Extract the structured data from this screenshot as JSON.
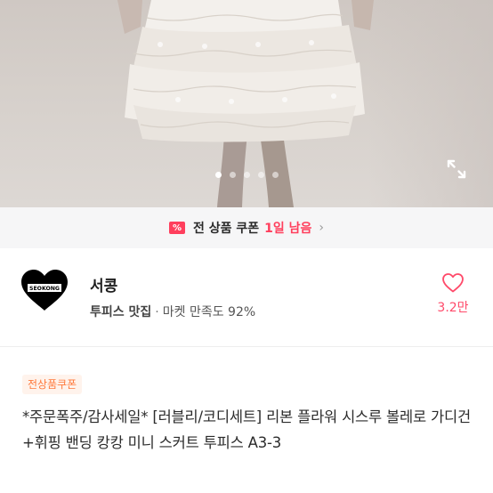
{
  "gallery": {
    "dots": [
      true,
      false,
      false,
      false,
      false
    ],
    "expand_icon": "expand-icon"
  },
  "coupon_bar": {
    "icon": "coupon-icon",
    "icon_glyph": "%",
    "text": "전 상품 쿠폰",
    "remaining": "1일 남음",
    "chevron": "›",
    "accent": "#ff3f5d"
  },
  "shop": {
    "logo_text": "SEOKONG",
    "name": "서콩",
    "category": "투피스 맛집",
    "separator": "·",
    "satisfaction": "마켓 만족도 92%",
    "favorite_icon": "heart-icon",
    "favorite_count": "3.2만",
    "favorite_color": "#ff4a6a"
  },
  "product": {
    "badge": "전상품쿠폰",
    "title": "*주문폭주/감사세일* [러블리/코디세트] 리본 플라워 시스루 볼레로 가디건+휘핑 밴딩 캉캉 미니 스커트 투피스 A3-3"
  }
}
